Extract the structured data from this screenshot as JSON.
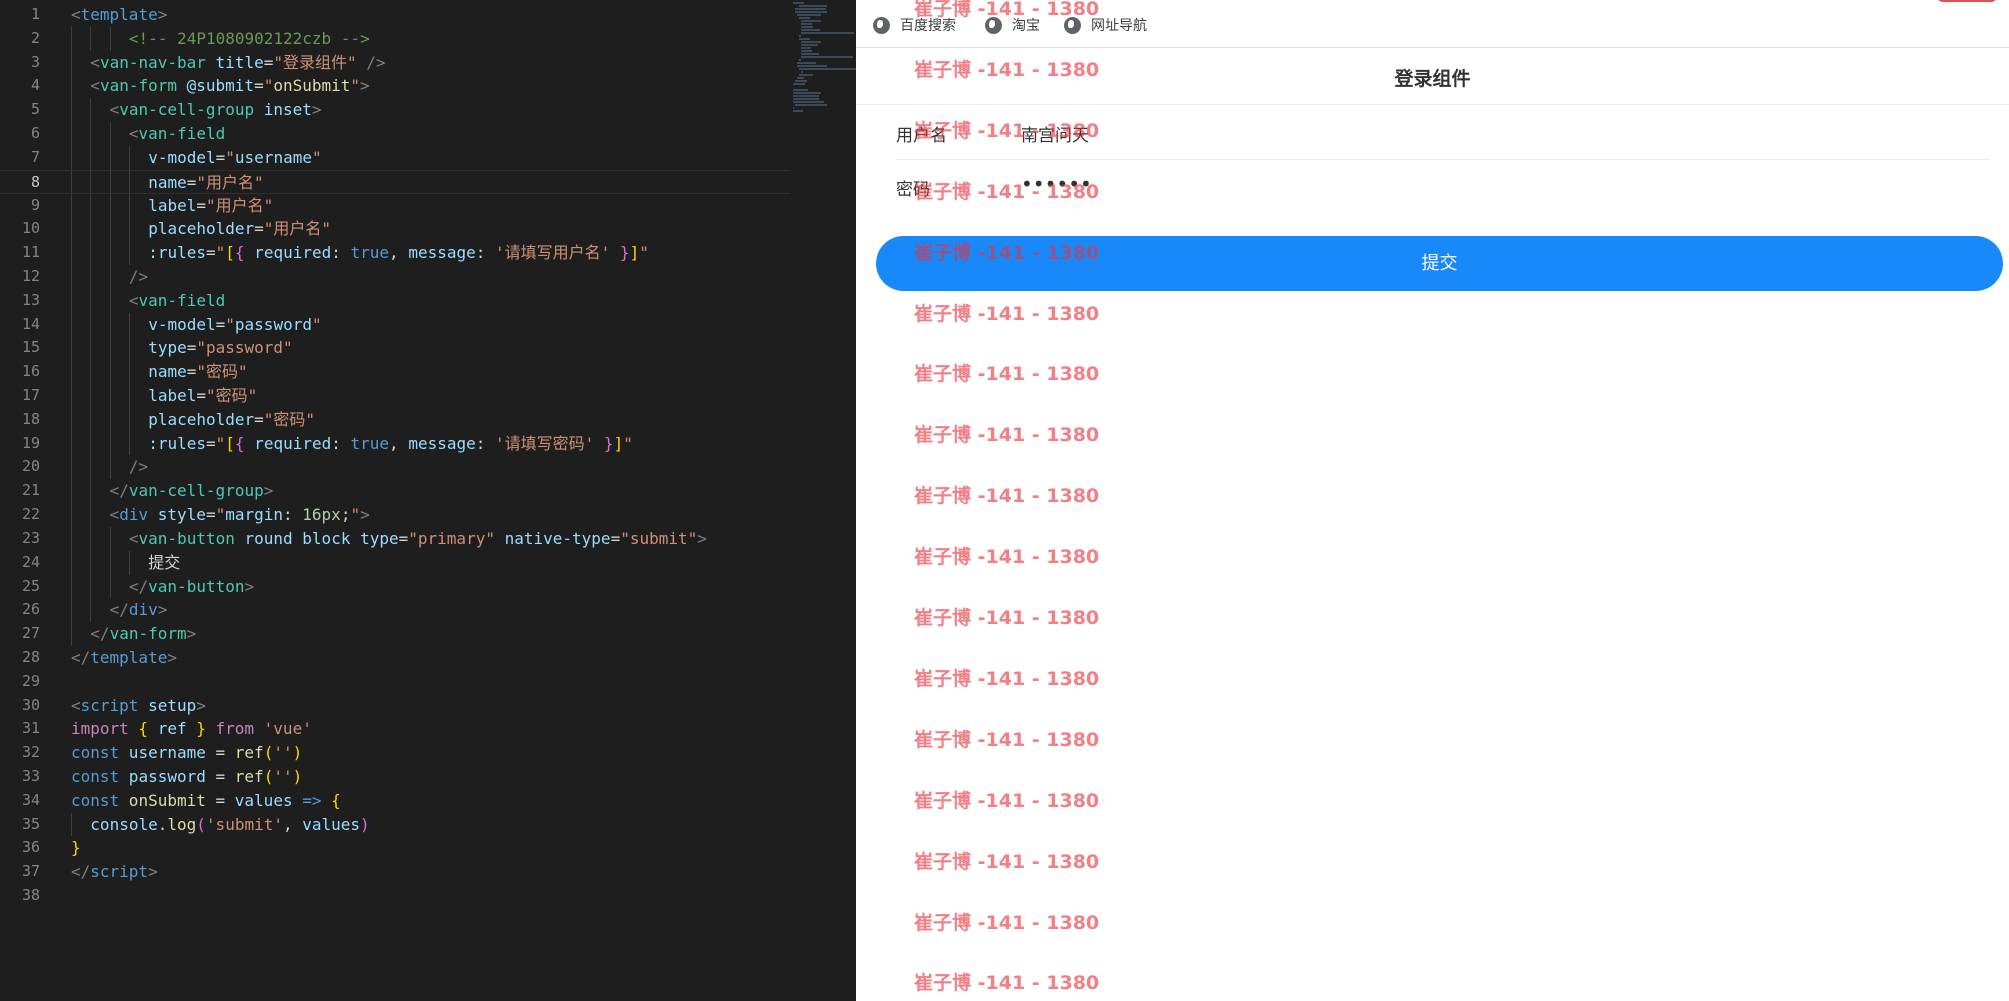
{
  "editor": {
    "current_line": 8,
    "lines": [
      {
        "n": 1,
        "indent": 0,
        "tokens": [
          [
            "t-punc",
            "<"
          ],
          [
            "t-tag",
            "template"
          ],
          [
            "t-punc",
            ">"
          ]
        ]
      },
      {
        "n": 2,
        "indent": 3,
        "tokens": [
          [
            "t-cmt",
            "<!-- 24P1080902122czb -->"
          ]
        ]
      },
      {
        "n": 3,
        "indent": 1,
        "tokens": [
          [
            "t-punc",
            "<"
          ],
          [
            "t-comp",
            "van-nav-bar"
          ],
          [
            "",
            ""
          ],
          [
            "t-attr",
            " title"
          ],
          [
            "",
            "="
          ],
          [
            "t-str",
            "\"登录组件\""
          ],
          [
            "t-punc",
            " />"
          ]
        ]
      },
      {
        "n": 4,
        "indent": 1,
        "tokens": [
          [
            "t-punc",
            "<"
          ],
          [
            "t-comp",
            "van-form"
          ],
          [
            "t-attr",
            " @submit"
          ],
          [
            "",
            "="
          ],
          [
            "t-str",
            "\""
          ],
          [
            "t-fn",
            "onSubmit"
          ],
          [
            "t-str",
            "\""
          ],
          [
            "t-punc",
            ">"
          ]
        ]
      },
      {
        "n": 5,
        "indent": 2,
        "tokens": [
          [
            "t-punc",
            "<"
          ],
          [
            "t-comp",
            "van-cell-group"
          ],
          [
            "t-attr",
            " inset"
          ],
          [
            "t-punc",
            ">"
          ]
        ]
      },
      {
        "n": 6,
        "indent": 3,
        "tokens": [
          [
            "t-punc",
            "<"
          ],
          [
            "t-comp",
            "van-field"
          ]
        ]
      },
      {
        "n": 7,
        "indent": 4,
        "tokens": [
          [
            "t-attr",
            "v-model"
          ],
          [
            "",
            "="
          ],
          [
            "t-str",
            "\""
          ],
          [
            "t-var",
            "username"
          ],
          [
            "t-str",
            "\""
          ]
        ]
      },
      {
        "n": 8,
        "indent": 4,
        "tokens": [
          [
            "t-attr",
            "name"
          ],
          [
            "",
            "="
          ],
          [
            "t-str",
            "\"用户名\""
          ]
        ]
      },
      {
        "n": 9,
        "indent": 4,
        "tokens": [
          [
            "t-attr",
            "label"
          ],
          [
            "",
            "="
          ],
          [
            "t-str",
            "\"用户名\""
          ]
        ]
      },
      {
        "n": 10,
        "indent": 4,
        "tokens": [
          [
            "t-attr",
            "placeholder"
          ],
          [
            "",
            "="
          ],
          [
            "t-str",
            "\"用户名\""
          ]
        ]
      },
      {
        "n": 11,
        "indent": 4,
        "tokens": [
          [
            "t-attr",
            ":rules"
          ],
          [
            "",
            "="
          ],
          [
            "t-str",
            "\""
          ],
          [
            "t-b1",
            "["
          ],
          [
            "t-b2",
            "{"
          ],
          [
            "t-var",
            " required"
          ],
          [
            "",
            ": "
          ],
          [
            "t-bool",
            "true"
          ],
          [
            "",
            ", "
          ],
          [
            "t-var",
            "message"
          ],
          [
            "",
            ": "
          ],
          [
            "t-str",
            "'请填写用户名'"
          ],
          [
            "t-b2",
            " }"
          ],
          [
            "t-b1",
            "]"
          ],
          [
            "t-str",
            "\""
          ]
        ]
      },
      {
        "n": 12,
        "indent": 3,
        "tokens": [
          [
            "t-punc",
            "/>"
          ]
        ]
      },
      {
        "n": 13,
        "indent": 3,
        "tokens": [
          [
            "t-punc",
            "<"
          ],
          [
            "t-comp",
            "van-field"
          ]
        ]
      },
      {
        "n": 14,
        "indent": 4,
        "tokens": [
          [
            "t-attr",
            "v-model"
          ],
          [
            "",
            "="
          ],
          [
            "t-str",
            "\""
          ],
          [
            "t-var",
            "password"
          ],
          [
            "t-str",
            "\""
          ]
        ]
      },
      {
        "n": 15,
        "indent": 4,
        "tokens": [
          [
            "t-attr",
            "type"
          ],
          [
            "",
            "="
          ],
          [
            "t-str",
            "\"password\""
          ]
        ]
      },
      {
        "n": 16,
        "indent": 4,
        "tokens": [
          [
            "t-attr",
            "name"
          ],
          [
            "",
            "="
          ],
          [
            "t-str",
            "\"密码\""
          ]
        ]
      },
      {
        "n": 17,
        "indent": 4,
        "tokens": [
          [
            "t-attr",
            "label"
          ],
          [
            "",
            "="
          ],
          [
            "t-str",
            "\"密码\""
          ]
        ]
      },
      {
        "n": 18,
        "indent": 4,
        "tokens": [
          [
            "t-attr",
            "placeholder"
          ],
          [
            "",
            "="
          ],
          [
            "t-str",
            "\"密码\""
          ]
        ]
      },
      {
        "n": 19,
        "indent": 4,
        "tokens": [
          [
            "t-attr",
            ":rules"
          ],
          [
            "",
            "="
          ],
          [
            "t-str",
            "\""
          ],
          [
            "t-b1",
            "["
          ],
          [
            "t-b2",
            "{"
          ],
          [
            "t-var",
            " required"
          ],
          [
            "",
            ": "
          ],
          [
            "t-bool",
            "true"
          ],
          [
            "",
            ", "
          ],
          [
            "t-var",
            "message"
          ],
          [
            "",
            ": "
          ],
          [
            "t-str",
            "'请填写密码'"
          ],
          [
            "t-b2",
            " }"
          ],
          [
            "t-b1",
            "]"
          ],
          [
            "t-str",
            "\""
          ]
        ]
      },
      {
        "n": 20,
        "indent": 3,
        "tokens": [
          [
            "t-punc",
            "/>"
          ]
        ]
      },
      {
        "n": 21,
        "indent": 2,
        "tokens": [
          [
            "t-punc",
            "</"
          ],
          [
            "t-comp",
            "van-cell-group"
          ],
          [
            "t-punc",
            ">"
          ]
        ]
      },
      {
        "n": 22,
        "indent": 2,
        "tokens": [
          [
            "t-punc",
            "<"
          ],
          [
            "t-tag",
            "div"
          ],
          [
            "t-attr",
            " style"
          ],
          [
            "",
            "="
          ],
          [
            "t-str",
            "\""
          ],
          [
            "t-var",
            "margin"
          ],
          [
            "",
            ": "
          ],
          [
            "t-num",
            "16px"
          ],
          [
            "",
            ";"
          ],
          [
            "t-str",
            "\""
          ],
          [
            "t-punc",
            ">"
          ]
        ]
      },
      {
        "n": 23,
        "indent": 3,
        "tokens": [
          [
            "t-punc",
            "<"
          ],
          [
            "t-comp",
            "van-button"
          ],
          [
            "t-attr",
            " round"
          ],
          [
            "t-attr",
            " block"
          ],
          [
            "t-attr",
            " type"
          ],
          [
            "",
            "="
          ],
          [
            "t-str",
            "\"primary\""
          ],
          [
            "t-attr",
            " native-type"
          ],
          [
            "",
            "="
          ],
          [
            "t-str",
            "\"submit\""
          ],
          [
            "t-punc",
            ">"
          ]
        ]
      },
      {
        "n": 24,
        "indent": 4,
        "tokens": [
          [
            "",
            "提交"
          ]
        ]
      },
      {
        "n": 25,
        "indent": 3,
        "tokens": [
          [
            "t-punc",
            "</"
          ],
          [
            "t-comp",
            "van-button"
          ],
          [
            "t-punc",
            ">"
          ]
        ]
      },
      {
        "n": 26,
        "indent": 2,
        "tokens": [
          [
            "t-punc",
            "</"
          ],
          [
            "t-tag",
            "div"
          ],
          [
            "t-punc",
            ">"
          ]
        ]
      },
      {
        "n": 27,
        "indent": 1,
        "tokens": [
          [
            "t-punc",
            "</"
          ],
          [
            "t-comp",
            "van-form"
          ],
          [
            "t-punc",
            ">"
          ]
        ]
      },
      {
        "n": 28,
        "indent": 0,
        "tokens": [
          [
            "t-punc",
            "</"
          ],
          [
            "t-tag",
            "template"
          ],
          [
            "t-punc",
            ">"
          ]
        ]
      },
      {
        "n": 29,
        "indent": 0,
        "tokens": []
      },
      {
        "n": 30,
        "indent": 0,
        "tokens": [
          [
            "t-punc",
            "<"
          ],
          [
            "t-tag",
            "script"
          ],
          [
            "t-attr",
            " setup"
          ],
          [
            "t-punc",
            ">"
          ]
        ]
      },
      {
        "n": 31,
        "indent": 0,
        "tokens": [
          [
            "t-kw",
            "import"
          ],
          [
            "t-b1",
            " {"
          ],
          [
            "t-var",
            " ref"
          ],
          [
            "t-b1",
            " }"
          ],
          [
            "t-kw",
            " from"
          ],
          [
            "t-str",
            " 'vue'"
          ]
        ]
      },
      {
        "n": 32,
        "indent": 0,
        "tokens": [
          [
            "t-decl",
            "const"
          ],
          [
            "t-var",
            " username"
          ],
          [
            "",
            " = "
          ],
          [
            "t-fn",
            "ref"
          ],
          [
            "t-b1",
            "("
          ],
          [
            "t-str",
            "''"
          ],
          [
            "t-b1",
            ")"
          ]
        ]
      },
      {
        "n": 33,
        "indent": 0,
        "tokens": [
          [
            "t-decl",
            "const"
          ],
          [
            "t-var",
            " password"
          ],
          [
            "",
            " = "
          ],
          [
            "t-fn",
            "ref"
          ],
          [
            "t-b1",
            "("
          ],
          [
            "t-str",
            "''"
          ],
          [
            "t-b1",
            ")"
          ]
        ]
      },
      {
        "n": 34,
        "indent": 0,
        "tokens": [
          [
            "t-decl",
            "const"
          ],
          [
            "t-fn",
            " onSubmit"
          ],
          [
            "",
            " = "
          ],
          [
            "t-var",
            "values"
          ],
          [
            "t-decl",
            " =>"
          ],
          [
            "t-b1",
            " {"
          ]
        ]
      },
      {
        "n": 35,
        "indent": 1,
        "tokens": [
          [
            "t-var",
            "console"
          ],
          [
            "",
            "."
          ],
          [
            "t-fn",
            "log"
          ],
          [
            "t-b2",
            "("
          ],
          [
            "t-str",
            "'submit'"
          ],
          [
            "",
            ", "
          ],
          [
            "t-var",
            "values"
          ],
          [
            "t-b2",
            ")"
          ]
        ]
      },
      {
        "n": 36,
        "indent": 0,
        "tokens": [
          [
            "t-b1",
            "}"
          ]
        ]
      },
      {
        "n": 37,
        "indent": 0,
        "tokens": [
          [
            "t-punc",
            "</"
          ],
          [
            "t-tag",
            "script"
          ],
          [
            "t-punc",
            ">"
          ]
        ]
      },
      {
        "n": 38,
        "indent": 0,
        "tokens": []
      }
    ]
  },
  "browser": {
    "bookmarks": [
      {
        "label": "百度搜索",
        "icon": "globe-icon"
      },
      {
        "label": "淘宝",
        "icon": "globe-icon"
      },
      {
        "label": "网址导航",
        "icon": "globe-icon"
      }
    ]
  },
  "app": {
    "nav_title": "登录组件",
    "fields": [
      {
        "label": "用户名",
        "value": "南宫问天"
      },
      {
        "label": "密码",
        "value": "••••••"
      }
    ],
    "submit_label": "提交",
    "accent_color": "#1989fa"
  },
  "watermark": {
    "text": "崔子博 -141 - 1380",
    "repeat": 17,
    "color": "#e8303a"
  }
}
